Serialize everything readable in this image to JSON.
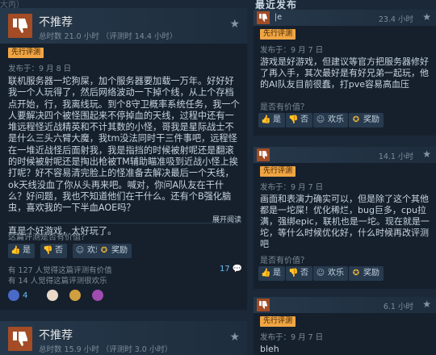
{
  "left": {
    "breadcrumb": "大丙）",
    "review1": {
      "verdict": "不推荐",
      "hours": "总时数 21.0 小时 （评测时 14.4 小时）",
      "tag": "先行评测",
      "posted": "发布于：9 月 8 日",
      "paragraphs": [
        "联机服务器一坨狗屎，加个服务器要加载一万年。好好好我一个人玩得了，然后网络波动一下掉个线，从上个存档点开始，行，我离线玩。到个8守卫概率系统任务，我一个人要解决四个被怪围起来不停掉血的天线，过程中还有一堆远程怪近战精英和不计其数的小怪，哥我是星际战士不是什么三头六臂大魔，我tm没法同时干三件事吧，远程怪在一堆近战怪后面射我，我是指挡的时候被射呢还是翻滚的时候被射呢还是掏出枪被TM辅助瞄准吸到近战小怪上挨打呢？好不容易清完脸上的怪准备去解决最后一个天线，ok天线没血了你从头再来吧。喊对，你问A队友在干什么？好问题，我也不知道他们在干什么。还有个B强化脑虫，喜欢我的一下半血AOE吗？",
        "真是个好游戏，太好玩了。"
      ],
      "expand": "展开阅读",
      "helpful_question": "这篇评测是否有价值？",
      "yes": "是",
      "no": "否",
      "funny": "欢乐",
      "award": "奖励",
      "votes_helpful": "有 127 人觉得这篇评测有价值",
      "votes_funny": "有 14 人觉得这篇评测很欢乐",
      "comments": "17",
      "awards": [
        "4",
        "",
        "",
        ""
      ]
    },
    "review2": {
      "verdict": "不推荐",
      "hours": "总时数 15.9 小时 （评测时 3.0 小时）"
    }
  },
  "right": {
    "section_title": "最近发布",
    "top_user": "|e",
    "review_a": {
      "hours": "23.4 小时",
      "tag": "先行评测",
      "posted": "发布于：9 月 7 日",
      "text": "游戏是好游戏，但建议等官方把服务器修好了再入手，其次最好是有好兄弟一起玩，他的AI队友目前很蠢，打pve容易高血压",
      "helpful_question": "是否有价值？",
      "yes": "是",
      "no": "否",
      "funny": "欢乐",
      "award": "奖励"
    },
    "review_b": {
      "hours": "14.1 小时",
      "tag": "先行评测",
      "posted": "发布于：9 月 7 日",
      "text": "画面和表演力确实可以，但是除了这个其他都是一坨屎！优化稀烂，bug巨多，cpu拉满，强绑epic，联机也是一坨。现在就是一坨，等什么时候优化好，什么时候再改评测吧",
      "helpful_question": "是否有价值？",
      "yes": "是",
      "no": "否",
      "funny": "欢乐",
      "award": "奖励"
    },
    "review_c": {
      "hours": "6.1 小时",
      "tag": "先行评测",
      "posted": "发布于：9 月 7 日",
      "text": "bleh"
    }
  },
  "colors": {
    "background": "#1b2838",
    "card": "#16202d",
    "thumb_down": "#a34c25",
    "tag": "#f0a544",
    "link": "#66c0f4"
  },
  "icons": [
    "thumbs-down-icon",
    "star-icon",
    "thumbs-up-icon",
    "laugh-icon",
    "award-icon",
    "comment-icon"
  ]
}
